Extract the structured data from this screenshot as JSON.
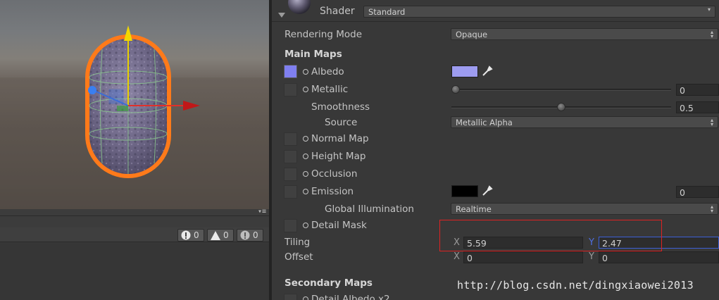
{
  "scene": {},
  "console": {
    "menu_glyph": "▾≡",
    "info_count": "0",
    "warning_count": "0",
    "error_count": "0"
  },
  "inspector": {
    "shader_label": "Shader",
    "shader_value": "Standard",
    "rendering_mode_label": "Rendering Mode",
    "rendering_mode_value": "Opaque",
    "main_maps_header": "Main Maps",
    "albedo_label": "Albedo",
    "albedo_color": "#9d9cf0",
    "metallic_label": "Metallic",
    "metallic_value": "0",
    "metallic_level": 0.0,
    "smoothness_label": "Smoothness",
    "smoothness_value": "0.5",
    "smoothness_level": 0.5,
    "source_label": "Source",
    "source_value": "Metallic Alpha",
    "normal_map_label": "Normal Map",
    "height_map_label": "Height Map",
    "occlusion_label": "Occlusion",
    "emission_label": "Emission",
    "emission_color": "#000000",
    "emission_value": "0",
    "global_illumination_label": "Global Illumination",
    "global_illumination_value": "Realtime",
    "detail_mask_label": "Detail Mask",
    "tiling_label": "Tiling",
    "tiling_x_label": "X",
    "tiling_x": "5.59",
    "tiling_y_label": "Y",
    "tiling_y": "2.47",
    "offset_label": "Offset",
    "offset_x_label": "X",
    "offset_x": "0",
    "offset_y_label": "Y",
    "offset_y": "0",
    "secondary_maps_header": "Secondary Maps",
    "detail_albedo_label": "Detail Albedo x2"
  },
  "watermark": "http://blog.csdn.net/dingxiaowei2013",
  "colors": {
    "selection_outline": "#ff7a1a",
    "highlight_box": "#dd2222",
    "active_field_border": "#3c5fd6"
  }
}
